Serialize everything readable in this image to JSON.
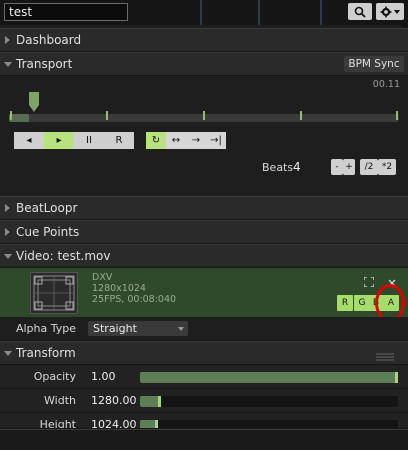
{
  "search": {
    "value": "test"
  },
  "toolbar": {
    "search_icon": "search-icon",
    "settings_icon": "gear-icon"
  },
  "sections": {
    "dashboard": "Dashboard",
    "transport": "Transport",
    "beatloopr": "BeatLoopr",
    "cue_points": "Cue Points",
    "video": "Video: test.mov",
    "transform": "Transform"
  },
  "transport": {
    "sync_mode": "BPM Sync",
    "timecode": "00.11",
    "progress_fraction": 0.05,
    "buttons": {
      "prev": "◂",
      "play": "▸",
      "pause": "II",
      "restart": "R",
      "loop": "↻",
      "bounce": "↔",
      "forward": "→",
      "end": "→|"
    },
    "beats_label": "Beats",
    "beats_value": "4",
    "minus": "-",
    "plus": "+",
    "halve": "/2",
    "double": "*2"
  },
  "video": {
    "codec": "DXV",
    "resolution": "1280x1024",
    "fps_duration": "25FPS, 00:08:040",
    "channels": [
      "R",
      "G",
      "B",
      "A"
    ]
  },
  "alpha": {
    "label": "Alpha Type",
    "value": "Straight"
  },
  "transform": {
    "rows": [
      {
        "label": "Opacity",
        "value": "1.00",
        "fraction": 1.0
      },
      {
        "label": "Width",
        "value": "1280.00",
        "fraction": 0.08
      },
      {
        "label": "Height",
        "value": "1024.00",
        "fraction": 0.07
      }
    ]
  },
  "colors": {
    "accent": "#a6dc6a",
    "highlight": "#e00000",
    "video_bg": "#2f4a2a"
  }
}
